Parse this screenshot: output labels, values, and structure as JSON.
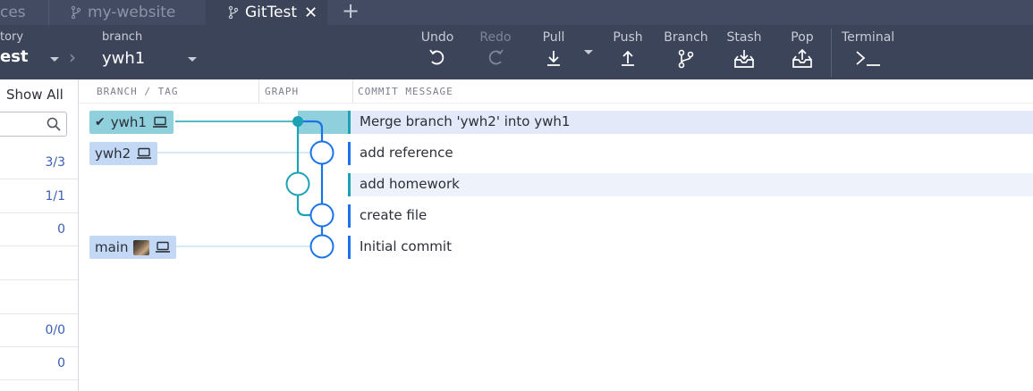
{
  "tabs": [
    {
      "label": "ces",
      "active": false
    },
    {
      "label": "my-website",
      "active": false
    },
    {
      "label": "GitTest",
      "active": true
    }
  ],
  "toolbar": {
    "repo_label": "tory",
    "repo_value": "est",
    "branch_label": "branch",
    "branch_value": "ywh1",
    "actions": {
      "undo": "Undo",
      "redo": "Redo",
      "pull": "Pull",
      "push": "Push",
      "branch": "Branch",
      "stash": "Stash",
      "pop": "Pop",
      "terminal": "Terminal"
    }
  },
  "left_panel": {
    "show_all": "Show All",
    "counts": [
      "3/3",
      "1/1",
      "0",
      "",
      "",
      "0/0",
      "0"
    ]
  },
  "columns": {
    "branch_tag": "BRANCH / TAG",
    "graph": "GRAPH",
    "commit_message": "COMMIT MESSAGE"
  },
  "commits": [
    {
      "message": "Merge branch 'ywh2' into ywh1",
      "branch": "ywh1",
      "checked_out": true
    },
    {
      "message": "add reference",
      "branch": "ywh2"
    },
    {
      "message": "add homework",
      "branch": ""
    },
    {
      "message": "create file",
      "branch": ""
    },
    {
      "message": "Initial commit",
      "branch": "main"
    }
  ],
  "icons": [
    "undo-icon",
    "redo-icon",
    "pull-icon",
    "push-icon",
    "branch-icon",
    "stash-icon",
    "pop-icon",
    "terminal-icon",
    "search-icon",
    "laptop-icon",
    "check-icon"
  ],
  "colors": {
    "toolbar_bg": "#3c4459",
    "tabbar_bg": "#424b62",
    "lane_blue": "#1a73e8",
    "lane_teal": "#1da1b5",
    "selected_row": "#e3e9f8",
    "branch_tag_active": "#8fd0dc",
    "branch_tag": "#c3d8f5"
  }
}
